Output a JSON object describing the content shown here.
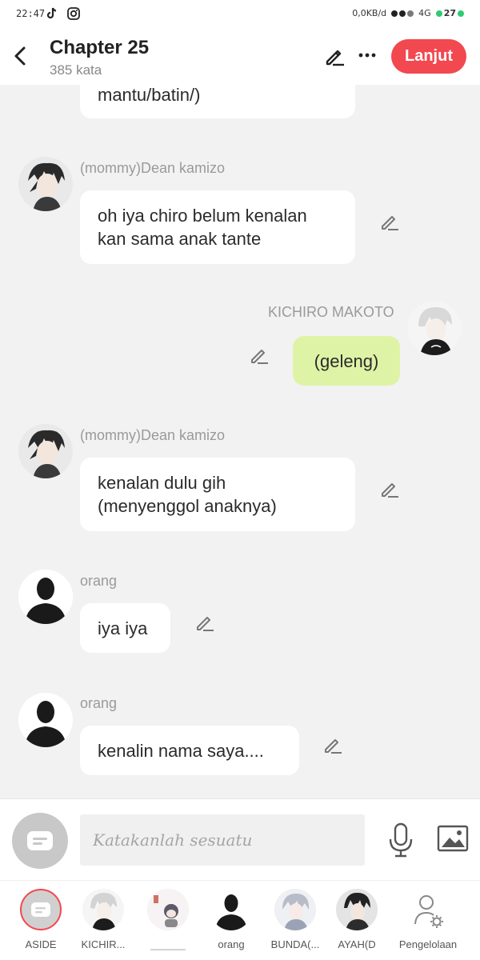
{
  "status_bar": {
    "time": "22:47",
    "net_speed": "0,0KB/d",
    "network": "4G",
    "battery": "27"
  },
  "header": {
    "title": "Chapter 25",
    "subtitle": "385 kata",
    "continue_label": "Lanjut"
  },
  "messages": [
    {
      "side": "left",
      "speaker": "",
      "text": "mantu/batin/)"
    },
    {
      "side": "left",
      "speaker": "(mommy)Dean kamizo",
      "text_lines": [
        "oh iya chiro belum kenalan",
        "kan sama anak tante"
      ]
    },
    {
      "side": "right",
      "speaker": "KICHIRO MAKOTO",
      "text": "(geleng)"
    },
    {
      "side": "left",
      "speaker": "(mommy)Dean kamizo",
      "text_lines": [
        "kenalan dulu gih",
        "(menyenggol anaknya)"
      ]
    },
    {
      "side": "left",
      "speaker": "orang",
      "text": "iya iya"
    },
    {
      "side": "left",
      "speaker": "orang",
      "text": "kenalin nama saya...."
    }
  ],
  "input": {
    "placeholder": "Katakanlah sesuatu"
  },
  "characters": [
    {
      "label": "ASIDE",
      "selected": true
    },
    {
      "label": "KICHIR..."
    },
    {
      "label": "______"
    },
    {
      "label": "orang"
    },
    {
      "label": "BUNDA(..."
    },
    {
      "label": "AYAH(D"
    },
    {
      "label": "Pengelolaan"
    }
  ],
  "colors": {
    "accent": "#f2484f",
    "my_bubble": "#dff3a6",
    "background": "#f2f2f2"
  }
}
